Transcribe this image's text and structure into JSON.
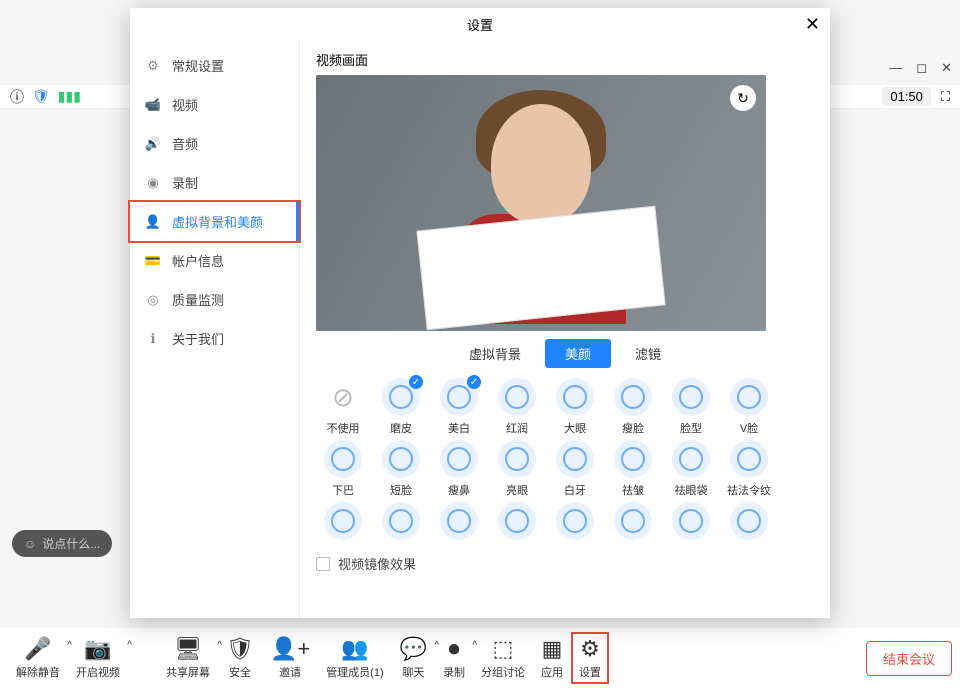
{
  "bg": {
    "timer": "01:50",
    "chat_placeholder": "说点什么..."
  },
  "toolbar": {
    "items": [
      {
        "icon": "🎤",
        "label": "解除静音",
        "caret": true
      },
      {
        "icon": "📷",
        "label": "开启视频",
        "caret": true
      },
      {
        "icon": "🖥",
        "label": "共享屏幕",
        "caret": true
      },
      {
        "icon": "🛡",
        "label": "安全"
      },
      {
        "icon": "👤+",
        "label": "邀请"
      },
      {
        "icon": "👥",
        "label": "管理成员(1)"
      },
      {
        "icon": "💬",
        "label": "聊天",
        "caret": true
      },
      {
        "icon": "⏺",
        "label": "录制",
        "caret": true
      },
      {
        "icon": "⬚",
        "label": "分组讨论"
      },
      {
        "icon": "▦",
        "label": "应用"
      },
      {
        "icon": "⚙",
        "label": "设置",
        "hl": true
      }
    ],
    "end": "结束会议"
  },
  "dialog": {
    "title": "设置",
    "sidebar": [
      {
        "icon": "⚙",
        "label": "常规设置"
      },
      {
        "icon": "📹",
        "label": "视频"
      },
      {
        "icon": "🔊",
        "label": "音频"
      },
      {
        "icon": "◉",
        "label": "录制"
      },
      {
        "icon": "👤",
        "label": "虚拟背景和美颜",
        "active": true,
        "hl": true
      },
      {
        "icon": "💳",
        "label": "帐户信息"
      },
      {
        "icon": "◎",
        "label": "质量监测"
      },
      {
        "icon": "ℹ",
        "label": "关于我们"
      }
    ],
    "content": {
      "preview_label": "视频画面",
      "subtabs": [
        "虚拟背景",
        "美颜",
        "滤镜"
      ],
      "subtab_active": 1,
      "beauty_grid": [
        {
          "label": "不使用",
          "none": true
        },
        {
          "label": "磨皮",
          "chk": true
        },
        {
          "label": "美白",
          "chk": true
        },
        {
          "label": "红润"
        },
        {
          "label": "大眼"
        },
        {
          "label": "瘦脸"
        },
        {
          "label": "脸型"
        },
        {
          "label": "V脸"
        },
        {
          "label": "下巴"
        },
        {
          "label": "短脸"
        },
        {
          "label": "瘦鼻"
        },
        {
          "label": "亮眼"
        },
        {
          "label": "白牙"
        },
        {
          "label": "祛皱"
        },
        {
          "label": "祛眼袋"
        },
        {
          "label": "祛法令纹"
        },
        {
          "label": ""
        },
        {
          "label": ""
        },
        {
          "label": ""
        },
        {
          "label": ""
        },
        {
          "label": ""
        },
        {
          "label": ""
        },
        {
          "label": ""
        },
        {
          "label": ""
        }
      ],
      "mirror": "视频镜像效果"
    }
  }
}
